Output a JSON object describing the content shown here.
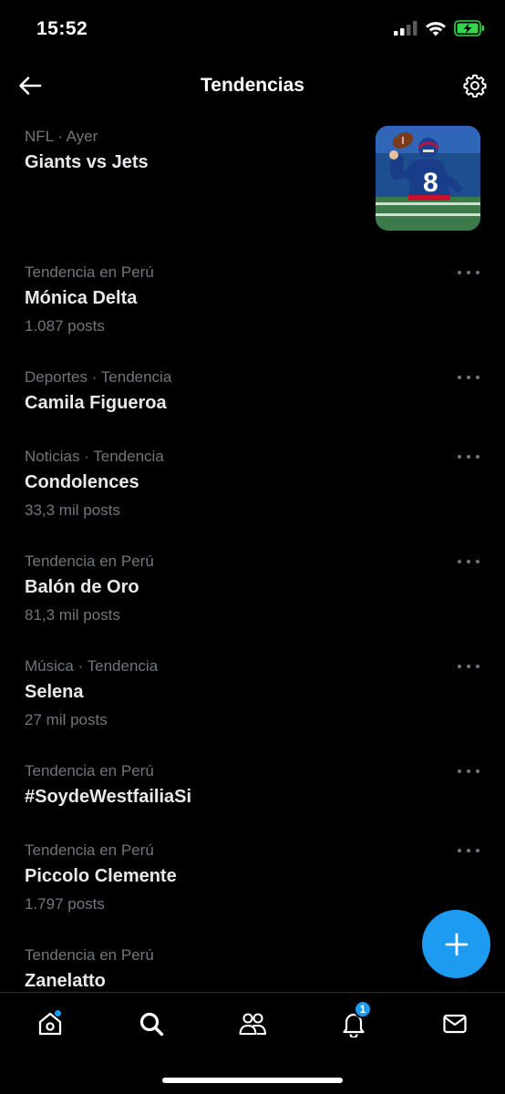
{
  "status_bar": {
    "time": "15:52",
    "icons": [
      "cellular-signal-icon",
      "wifi-icon",
      "battery-charging-icon"
    ]
  },
  "header": {
    "title": "Tendencias",
    "back_icon": "arrow-left-icon",
    "settings_icon": "gear-icon"
  },
  "trends": [
    {
      "meta": "NFL · Ayer",
      "title": "Giants vs Jets",
      "count": "",
      "has_image": true
    },
    {
      "meta": "Tendencia en Perú",
      "title": "Mónica Delta",
      "count": "1.087 posts"
    },
    {
      "meta": "Deportes · Tendencia",
      "title": "Camila Figueroa",
      "count": ""
    },
    {
      "meta": "Noticias · Tendencia",
      "title": "Condolences",
      "count": "33,3 mil posts"
    },
    {
      "meta": "Tendencia en Perú",
      "title": "Balón de Oro",
      "count": "81,3 mil posts"
    },
    {
      "meta": "Música · Tendencia",
      "title": "Selena",
      "count": "27 mil posts"
    },
    {
      "meta": "Tendencia en Perú",
      "title": "#SoydeWestfailiaSi",
      "count": ""
    },
    {
      "meta": "Tendencia en Perú",
      "title": "Piccolo Clemente",
      "count": "1.797 posts"
    },
    {
      "meta": "Tendencia en Perú",
      "title": "Zanelatto",
      "count": ""
    }
  ],
  "fab": {
    "icon": "plus-icon"
  },
  "tab_bar": {
    "tabs": [
      {
        "name": "home",
        "icon": "home-icon",
        "has_dot": true
      },
      {
        "name": "search",
        "icon": "search-icon"
      },
      {
        "name": "communities",
        "icon": "people-icon"
      },
      {
        "name": "notifications",
        "icon": "bell-icon",
        "badge": "1"
      },
      {
        "name": "messages",
        "icon": "mail-icon"
      }
    ]
  },
  "colors": {
    "accent": "#1d9bf0",
    "background": "#000000",
    "primary_text": "#e7e9ea",
    "secondary_text": "#71767b"
  }
}
